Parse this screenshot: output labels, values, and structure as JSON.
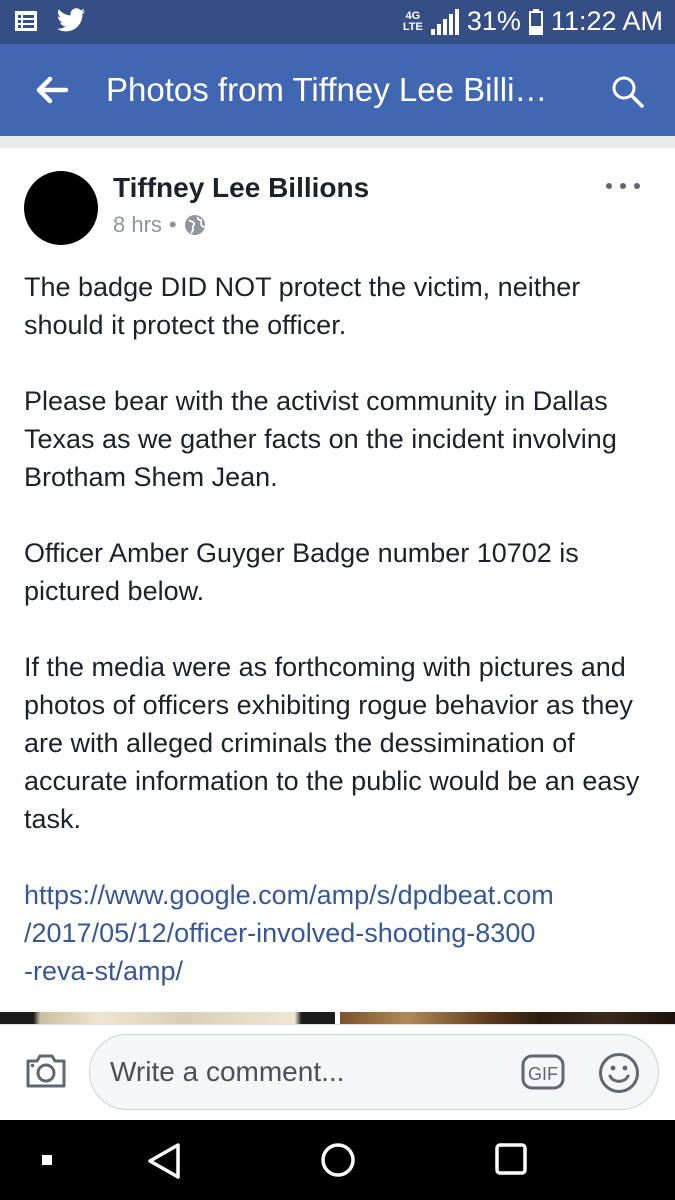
{
  "status_bar": {
    "network_top": "4G",
    "network_bottom": "LTE",
    "battery": "31%",
    "time": "11:22 AM"
  },
  "app_bar": {
    "title": "Photos from Tiffney Lee Billi…"
  },
  "post": {
    "author": "Tiffney Lee Billions",
    "time": "8 hrs",
    "separator": "•",
    "paragraphs": [
      "The badge DID NOT protect the victim, neither should it protect the officer.",
      "Please bear with the activist community in Dallas Texas as we gather facts on the incident involving Brotham Shem Jean.",
      "Officer Amber Guyger Badge number 10702 is pictured below.",
      "If the media were as forthcoming with pictures and photos of officers exhibiting rogue behavior as they are with alleged criminals the dessimination of accurate information to the public would be an easy task."
    ],
    "link_lines": [
      "https://www.google.com/amp/s/dpdbeat.com",
      "/2017/05/12/officer-involved-shooting-8300",
      "-reva-st/amp/"
    ]
  },
  "comment_bar": {
    "placeholder": "Write a comment...",
    "gif_label": "GIF"
  },
  "colors": {
    "status_bar": "#354f86",
    "app_bar": "#4267b2",
    "link": "#365899"
  }
}
